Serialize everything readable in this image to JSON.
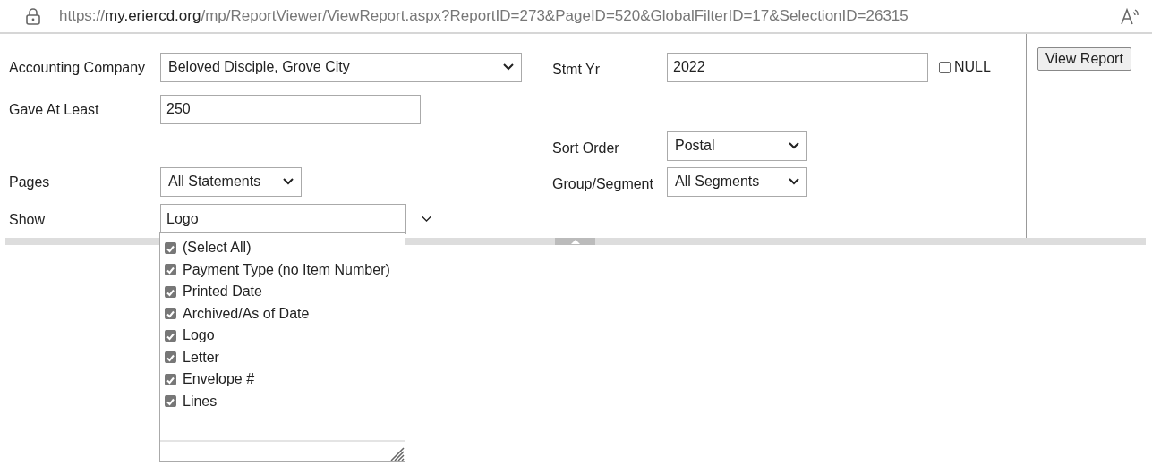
{
  "address_bar": {
    "url_scheme": "https://",
    "url_host": "my.eriercd.org",
    "url_path": "/mp/ReportViewer/ViewReport.aspx?ReportID=273&PageID=520&GlobalFilterID=17&SelectionID=26315"
  },
  "rows": [
    {
      "left": {
        "kind": "select",
        "label": "Accounting Company",
        "value": "Beloved Disciple, Grove City"
      },
      "right": {
        "kind": "text",
        "label": "Stmt Yr",
        "value": "2022",
        "null_option": {
          "label": "NULL",
          "checked": false
        }
      }
    },
    {
      "left": {
        "kind": "text",
        "label": "Gave At Least",
        "value": "250"
      }
    },
    {
      "right": {
        "kind": "select",
        "label": "Sort Order",
        "value": "Postal"
      }
    },
    {
      "left": {
        "kind": "select",
        "label": "Pages",
        "value": "All Statements"
      },
      "right": {
        "kind": "select",
        "label": "Group/Segment",
        "value": "All Segments"
      }
    },
    {
      "left": {
        "kind": "multiselect",
        "label": "Show",
        "value": "Logo",
        "expanded": true,
        "options": [
          {
            "label": "(Select All)",
            "checked": true
          },
          {
            "label": "Payment Type (no Item Number)",
            "checked": true
          },
          {
            "label": "Printed Date",
            "checked": true
          },
          {
            "label": "Archived/As of Date",
            "checked": true
          },
          {
            "label": "Logo",
            "checked": true
          },
          {
            "label": "Letter",
            "checked": true
          },
          {
            "label": "Envelope #",
            "checked": true
          },
          {
            "label": "Lines",
            "checked": true
          }
        ]
      }
    }
  ],
  "view_report_button": "View Report"
}
